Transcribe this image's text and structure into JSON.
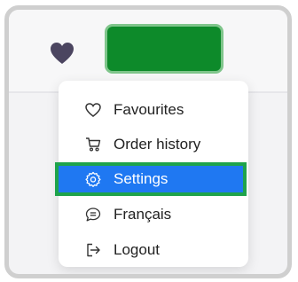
{
  "colors": {
    "accent_blue": "#1f78f2",
    "green_button": "#0d8a2a",
    "highlight_border": "#1ea34b",
    "heart": "#4b4560"
  },
  "menu": {
    "items": [
      {
        "label": "Favourites",
        "icon": "heart-outline-icon"
      },
      {
        "label": "Order history",
        "icon": "cart-icon"
      },
      {
        "label": "Settings",
        "icon": "gear-icon",
        "selected": true
      },
      {
        "label": "Français",
        "icon": "chat-bubble-icon"
      },
      {
        "label": "Logout",
        "icon": "logout-icon"
      }
    ]
  }
}
